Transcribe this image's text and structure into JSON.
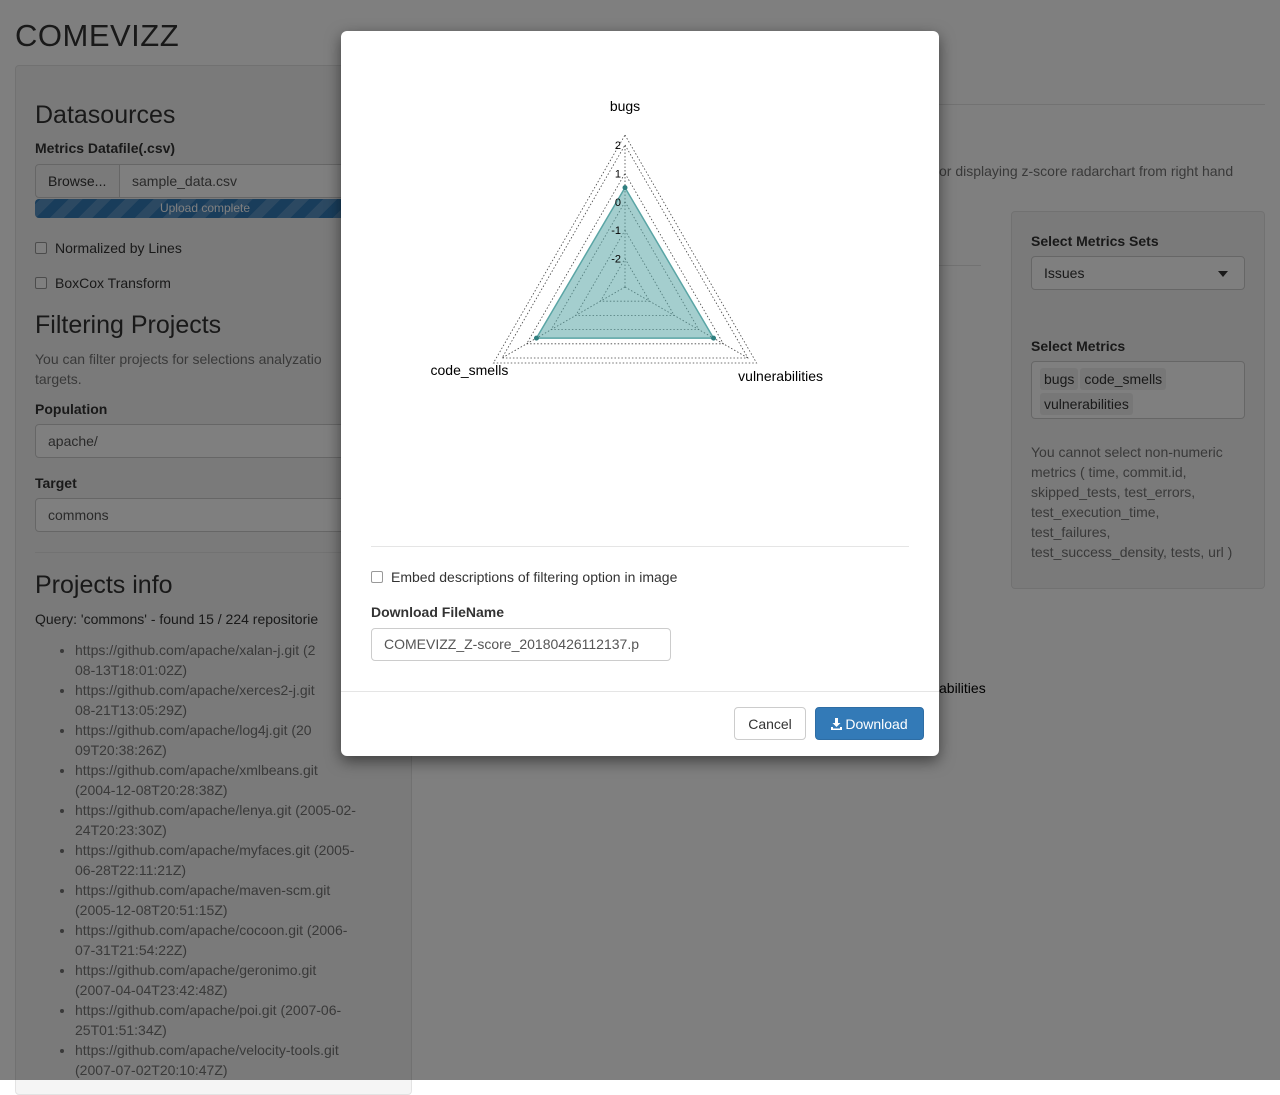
{
  "app": {
    "title": "COMEVIZZ"
  },
  "sidebar": {
    "datasources_heading": "Datasources",
    "datafile_label": "Metrics Datafile(.csv)",
    "browse_label": "Browse...",
    "file_name": "sample_data.csv",
    "upload_status": "Upload complete",
    "normalized_label": "Normalized by Lines",
    "boxcox_label": "BoxCox Transform",
    "filtering_heading": "Filtering Projects",
    "filtering_help_line1": "You can filter projects for selections analyzatio",
    "filtering_help_line2": "targets.",
    "population_label": "Population",
    "population_value": "apache/",
    "target_label": "Target",
    "target_value": "commons",
    "projects_heading": "Projects info",
    "query_text": "Query: 'commons' - found 15 / 224 repositorie",
    "projects": [
      {
        "line1": "https://github.com/apache/xalan-j.git (2",
        "line2": "08-13T18:01:02Z)"
      },
      {
        "line1": "https://github.com/apache/xerces2-j.git",
        "line2": "08-21T13:05:29Z)"
      },
      {
        "line1": "https://github.com/apache/log4j.git (20",
        "line2": "09T20:38:26Z)"
      },
      {
        "line1": "https://github.com/apache/xmlbeans.git",
        "line2": "(2004-12-08T20:28:38Z)"
      },
      {
        "line1": "https://github.com/apache/lenya.git (2005-02-",
        "line2": "24T20:23:30Z)"
      },
      {
        "line1": "https://github.com/apache/myfaces.git (2005-",
        "line2": "06-28T22:11:21Z)"
      },
      {
        "line1": "https://github.com/apache/maven-scm.git",
        "line2": "(2005-12-08T20:51:15Z)"
      },
      {
        "line1": "https://github.com/apache/cocoon.git (2006-",
        "line2": "07-31T21:54:22Z)"
      },
      {
        "line1": "https://github.com/apache/geronimo.git",
        "line2": "(2007-04-04T23:42:48Z)"
      },
      {
        "line1": "https://github.com/apache/poi.git (2007-06-",
        "line2": "25T01:51:34Z)"
      },
      {
        "line1": "https://github.com/apache/velocity-tools.git",
        "line2": "(2007-07-02T20:10:47Z)"
      }
    ]
  },
  "main": {
    "help_text": "or displaying z-score radarchart from right hand",
    "legend_fragment": "abilities"
  },
  "right_panel": {
    "metrics_sets_label": "Select Metrics Sets",
    "metrics_sets_value": "Issues",
    "metrics_label": "Select Metrics",
    "selected_metrics": [
      "bugs",
      "code_smells",
      "vulnerabilities"
    ],
    "note_lines": [
      "You cannot select non-numeric",
      "metrics ( time, commit.id,",
      "skipped_tests, test_errors,",
      "test_execution_time,",
      "test_failures,",
      "test_success_density, tests, url )"
    ]
  },
  "modal": {
    "embed_label": "Embed descriptions of filtering option in image",
    "filename_label": "Download FileName",
    "filename_value": "COMEVIZZ_Z-score_20180426112137.p",
    "cancel_label": "Cancel",
    "download_label": "Download",
    "icons": {
      "download": "download-icon"
    }
  },
  "chart_data": {
    "type": "radar",
    "axes": [
      "bugs",
      "vulnerabilities",
      "code_smells"
    ],
    "rlim": [
      -3,
      2
    ],
    "ticks": [
      2,
      1,
      0,
      -1,
      -2
    ],
    "series": [
      {
        "values": [
          0.5,
          0.6,
          0.6
        ],
        "color": "#5aa5a5"
      }
    ],
    "grid": "dotted"
  }
}
